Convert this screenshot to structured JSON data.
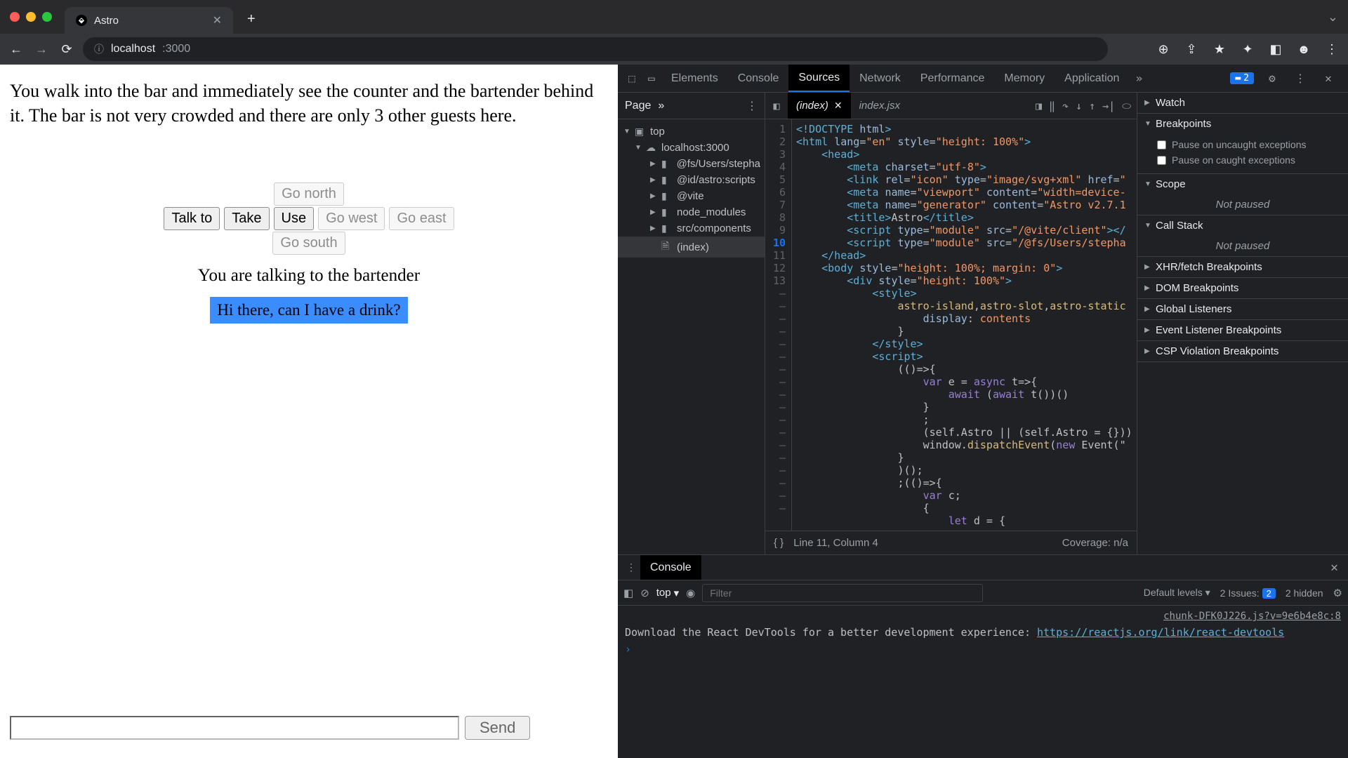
{
  "browser": {
    "tab_title": "Astro",
    "url_host": "localhost",
    "url_port": ":3000",
    "new_tab_tooltip": "+"
  },
  "game": {
    "description": "You walk into the bar and immediately see the counter and the bartender behind it. The bar is not very crowded and there are only 3 other guests here.",
    "buttons": {
      "talk_to": "Talk to",
      "take": "Take",
      "use": "Use",
      "go_north": "Go north",
      "go_west": "Go west",
      "go_east": "Go east",
      "go_south": "Go south"
    },
    "talking_to": "You are talking to the bartender",
    "dialog_option": "Hi there, can I have a drink?",
    "input_placeholder": "",
    "send_label": "Send"
  },
  "devtools": {
    "tabs": [
      "Elements",
      "Console",
      "Sources",
      "Network",
      "Performance",
      "Memory",
      "Application"
    ],
    "active_tab": "Sources",
    "issue_count": "2",
    "nav": {
      "page_tab": "Page",
      "tree": {
        "top": "top",
        "host": "localhost:3000",
        "folders": [
          "@fs/Users/stepha",
          "@id/astro:scripts",
          "@vite",
          "node_modules",
          "src/components"
        ],
        "file": "(index)"
      }
    },
    "editor": {
      "tabs": [
        "(index)",
        "index.jsx"
      ],
      "active": "(index)",
      "line_numbers": [
        "1",
        "2",
        "3",
        "4",
        "5",
        "6",
        "7",
        "8",
        "9",
        "10",
        "11",
        "12",
        "13",
        "–",
        "–",
        "–",
        "–",
        "–",
        "–",
        "–",
        "–",
        "–",
        "–",
        "–",
        "–",
        "–",
        "–",
        "–",
        "–",
        "–",
        "–"
      ],
      "highlighted_line": 10,
      "code_lines": [
        [
          {
            "cls": "c-tag",
            "t": "<!DOCTYPE "
          },
          {
            "cls": "c-attr",
            "t": "html"
          },
          {
            "cls": "c-tag",
            "t": ">"
          }
        ],
        [
          {
            "cls": "c-tag",
            "t": "<html "
          },
          {
            "cls": "c-attr",
            "t": "lang"
          },
          {
            "cls": "c-txt",
            "t": "="
          },
          {
            "cls": "c-str",
            "t": "\"en\""
          },
          {
            "cls": "c-txt",
            "t": " "
          },
          {
            "cls": "c-attr",
            "t": "style"
          },
          {
            "cls": "c-txt",
            "t": "="
          },
          {
            "cls": "c-str",
            "t": "\"height: 100%\""
          },
          {
            "cls": "c-tag",
            "t": ">"
          }
        ],
        [
          {
            "cls": "c-txt",
            "t": "    "
          },
          {
            "cls": "c-tag",
            "t": "<head>"
          }
        ],
        [
          {
            "cls": "c-txt",
            "t": "        "
          },
          {
            "cls": "c-tag",
            "t": "<meta "
          },
          {
            "cls": "c-attr",
            "t": "charset"
          },
          {
            "cls": "c-txt",
            "t": "="
          },
          {
            "cls": "c-str",
            "t": "\"utf-8\""
          },
          {
            "cls": "c-tag",
            "t": ">"
          }
        ],
        [
          {
            "cls": "c-txt",
            "t": "        "
          },
          {
            "cls": "c-tag",
            "t": "<link "
          },
          {
            "cls": "c-attr",
            "t": "rel"
          },
          {
            "cls": "c-txt",
            "t": "="
          },
          {
            "cls": "c-str",
            "t": "\"icon\""
          },
          {
            "cls": "c-txt",
            "t": " "
          },
          {
            "cls": "c-attr",
            "t": "type"
          },
          {
            "cls": "c-txt",
            "t": "="
          },
          {
            "cls": "c-str",
            "t": "\"image/svg+xml\""
          },
          {
            "cls": "c-txt",
            "t": " "
          },
          {
            "cls": "c-attr",
            "t": "href"
          },
          {
            "cls": "c-txt",
            "t": "="
          },
          {
            "cls": "c-str",
            "t": "\""
          }
        ],
        [
          {
            "cls": "c-txt",
            "t": "        "
          },
          {
            "cls": "c-tag",
            "t": "<meta "
          },
          {
            "cls": "c-attr",
            "t": "name"
          },
          {
            "cls": "c-txt",
            "t": "="
          },
          {
            "cls": "c-str",
            "t": "\"viewport\""
          },
          {
            "cls": "c-txt",
            "t": " "
          },
          {
            "cls": "c-attr",
            "t": "content"
          },
          {
            "cls": "c-txt",
            "t": "="
          },
          {
            "cls": "c-str",
            "t": "\"width=device-"
          }
        ],
        [
          {
            "cls": "c-txt",
            "t": "        "
          },
          {
            "cls": "c-tag",
            "t": "<meta "
          },
          {
            "cls": "c-attr",
            "t": "name"
          },
          {
            "cls": "c-txt",
            "t": "="
          },
          {
            "cls": "c-str",
            "t": "\"generator\""
          },
          {
            "cls": "c-txt",
            "t": " "
          },
          {
            "cls": "c-attr",
            "t": "content"
          },
          {
            "cls": "c-txt",
            "t": "="
          },
          {
            "cls": "c-str",
            "t": "\"Astro v2.7.1"
          }
        ],
        [
          {
            "cls": "c-txt",
            "t": "        "
          },
          {
            "cls": "c-tag",
            "t": "<title>"
          },
          {
            "cls": "c-txt",
            "t": "Astro"
          },
          {
            "cls": "c-tag",
            "t": "</title>"
          }
        ],
        [
          {
            "cls": "c-txt",
            "t": "        "
          },
          {
            "cls": "c-tag",
            "t": "<script "
          },
          {
            "cls": "c-attr",
            "t": "type"
          },
          {
            "cls": "c-txt",
            "t": "="
          },
          {
            "cls": "c-str",
            "t": "\"module\""
          },
          {
            "cls": "c-txt",
            "t": " "
          },
          {
            "cls": "c-attr",
            "t": "src"
          },
          {
            "cls": "c-txt",
            "t": "="
          },
          {
            "cls": "c-str",
            "t": "\"/@vite/client\""
          },
          {
            "cls": "c-tag",
            "t": "></"
          }
        ],
        [
          {
            "cls": "c-txt",
            "t": "        "
          },
          {
            "cls": "c-tag",
            "t": "<script "
          },
          {
            "cls": "c-attr",
            "t": "type"
          },
          {
            "cls": "c-txt",
            "t": "="
          },
          {
            "cls": "c-str",
            "t": "\"module\""
          },
          {
            "cls": "c-txt",
            "t": " "
          },
          {
            "cls": "c-attr",
            "t": "src"
          },
          {
            "cls": "c-txt",
            "t": "="
          },
          {
            "cls": "c-str",
            "t": "\"/@fs/Users/stepha"
          }
        ],
        [
          {
            "cls": "c-txt",
            "t": "    "
          },
          {
            "cls": "c-tag",
            "t": "</head>"
          }
        ],
        [
          {
            "cls": "c-txt",
            "t": "    "
          },
          {
            "cls": "c-tag",
            "t": "<body "
          },
          {
            "cls": "c-attr",
            "t": "style"
          },
          {
            "cls": "c-txt",
            "t": "="
          },
          {
            "cls": "c-str",
            "t": "\"height: 100%; margin: 0\""
          },
          {
            "cls": "c-tag",
            "t": ">"
          }
        ],
        [
          {
            "cls": "c-txt",
            "t": "        "
          },
          {
            "cls": "c-tag",
            "t": "<div "
          },
          {
            "cls": "c-attr",
            "t": "style"
          },
          {
            "cls": "c-txt",
            "t": "="
          },
          {
            "cls": "c-str",
            "t": "\"height: 100%\""
          },
          {
            "cls": "c-tag",
            "t": ">"
          }
        ],
        [
          {
            "cls": "c-txt",
            "t": "            "
          },
          {
            "cls": "c-tag",
            "t": "<style>"
          }
        ],
        [
          {
            "cls": "c-txt",
            "t": "                "
          },
          {
            "cls": "c-fn",
            "t": "astro-island"
          },
          {
            "cls": "c-txt",
            "t": ","
          },
          {
            "cls": "c-fn",
            "t": "astro-slot"
          },
          {
            "cls": "c-txt",
            "t": ","
          },
          {
            "cls": "c-fn",
            "t": "astro-static"
          }
        ],
        [
          {
            "cls": "c-txt",
            "t": "                    "
          },
          {
            "cls": "c-attr",
            "t": "display"
          },
          {
            "cls": "c-txt",
            "t": ": "
          },
          {
            "cls": "c-str",
            "t": "contents"
          }
        ],
        [
          {
            "cls": "c-txt",
            "t": "                }"
          }
        ],
        [
          {
            "cls": "c-txt",
            "t": "            "
          },
          {
            "cls": "c-tag",
            "t": "</style>"
          }
        ],
        [
          {
            "cls": "c-txt",
            "t": "            "
          },
          {
            "cls": "c-tag",
            "t": "<script>"
          }
        ],
        [
          {
            "cls": "c-txt",
            "t": "                (()=>{"
          }
        ],
        [
          {
            "cls": "c-txt",
            "t": "                    "
          },
          {
            "cls": "c-kw",
            "t": "var"
          },
          {
            "cls": "c-txt",
            "t": " e = "
          },
          {
            "cls": "c-kw",
            "t": "async"
          },
          {
            "cls": "c-txt",
            "t": " t=>{"
          }
        ],
        [
          {
            "cls": "c-txt",
            "t": "                        "
          },
          {
            "cls": "c-kw",
            "t": "await"
          },
          {
            "cls": "c-txt",
            "t": " ("
          },
          {
            "cls": "c-kw",
            "t": "await"
          },
          {
            "cls": "c-txt",
            "t": " t())()"
          }
        ],
        [
          {
            "cls": "c-txt",
            "t": "                    }"
          }
        ],
        [
          {
            "cls": "c-txt",
            "t": "                    ;"
          }
        ],
        [
          {
            "cls": "c-txt",
            "t": "                    (self.Astro || (self.Astro = {}))"
          }
        ],
        [
          {
            "cls": "c-txt",
            "t": "                    window."
          },
          {
            "cls": "c-fn",
            "t": "dispatchEvent"
          },
          {
            "cls": "c-txt",
            "t": "("
          },
          {
            "cls": "c-kw",
            "t": "new"
          },
          {
            "cls": "c-txt",
            "t": " Event(\""
          }
        ],
        [
          {
            "cls": "c-txt",
            "t": "                }"
          }
        ],
        [
          {
            "cls": "c-txt",
            "t": "                )();"
          }
        ],
        [
          {
            "cls": "c-txt",
            "t": "                ;(()=>{"
          }
        ],
        [
          {
            "cls": "c-txt",
            "t": "                    "
          },
          {
            "cls": "c-kw",
            "t": "var"
          },
          {
            "cls": "c-txt",
            "t": " c;"
          }
        ],
        [
          {
            "cls": "c-txt",
            "t": "                    {"
          }
        ],
        [
          {
            "cls": "c-txt",
            "t": "                        "
          },
          {
            "cls": "c-kw",
            "t": "let"
          },
          {
            "cls": "c-txt",
            "t": " d = {"
          }
        ]
      ],
      "status": {
        "cursor": "Line 11, Column 4",
        "coverage": "Coverage: n/a",
        "format_icon": "{ }"
      }
    },
    "debugger": {
      "watch": "Watch",
      "breakpoints": "Breakpoints",
      "pause_uncaught": "Pause on uncaught exceptions",
      "pause_caught": "Pause on caught exceptions",
      "scope": "Scope",
      "not_paused": "Not paused",
      "call_stack": "Call Stack",
      "sections": [
        "XHR/fetch Breakpoints",
        "DOM Breakpoints",
        "Global Listeners",
        "Event Listener Breakpoints",
        "CSP Violation Breakpoints"
      ]
    },
    "console": {
      "tab": "Console",
      "context": "top",
      "filter_placeholder": "Filter",
      "levels": "Default levels",
      "issues_label": "2 Issues:",
      "issues_count": "2",
      "hidden": "2 hidden",
      "log_source": "chunk-DFK0J226.js?v=9e6b4e8c:8",
      "log_text": "Download the React DevTools for a better development experience: ",
      "log_link": "https://reactjs.org/link/react-devtools"
    }
  }
}
